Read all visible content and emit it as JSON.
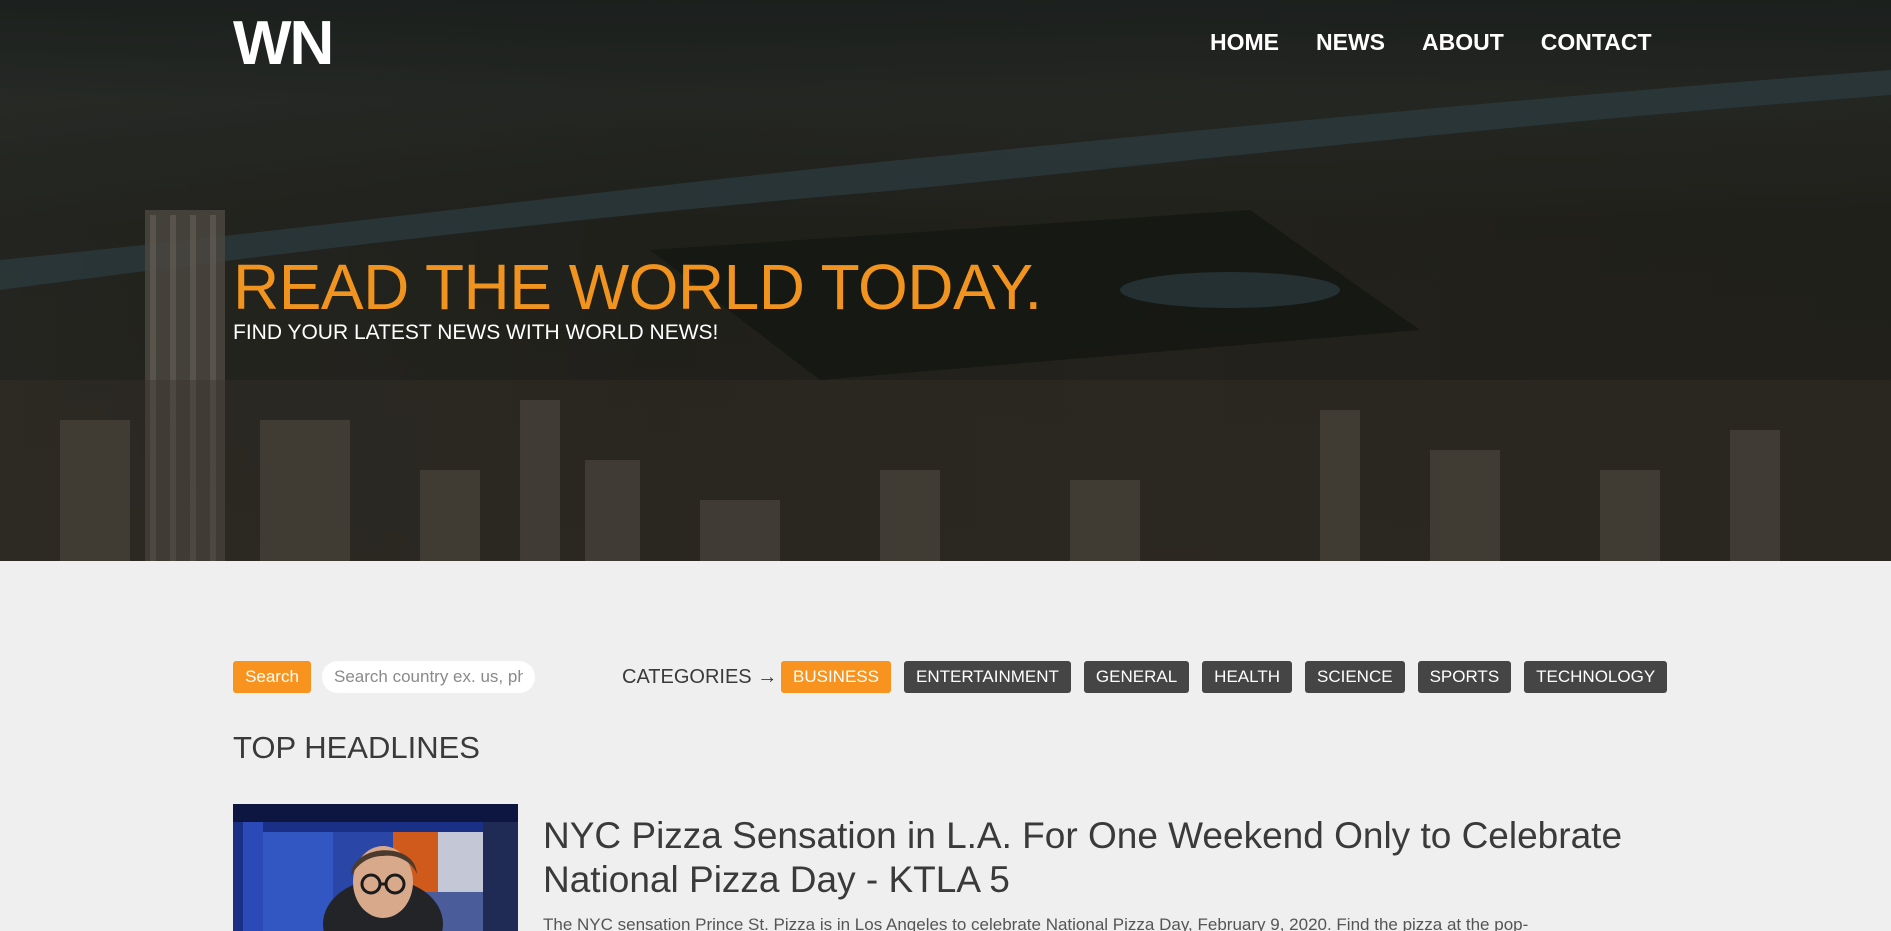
{
  "header": {
    "logo": "WN",
    "nav": [
      "HOME",
      "NEWS",
      "ABOUT",
      "CONTACT"
    ]
  },
  "hero": {
    "title": "READ THE WORLD TODAY.",
    "subtitle": "FIND YOUR LATEST NEWS WITH WORLD NEWS!"
  },
  "search": {
    "button_label": "Search",
    "placeholder": "Search country ex. us, ph"
  },
  "categories": {
    "label": "CATEGORIES →",
    "items": [
      {
        "label": "BUSINESS",
        "active": true
      },
      {
        "label": "ENTERTAINMENT",
        "active": false
      },
      {
        "label": "GENERAL",
        "active": false
      },
      {
        "label": "HEALTH",
        "active": false
      },
      {
        "label": "SCIENCE",
        "active": false
      },
      {
        "label": "SPORTS",
        "active": false
      },
      {
        "label": "TECHNOLOGY",
        "active": false
      }
    ]
  },
  "main": {
    "section_title": "TOP HEADLINES",
    "articles": [
      {
        "title": "NYC Pizza Sensation in L.A. For One Weekend Only to Celebrate National Pizza Day - KTLA 5",
        "description": "The NYC sensation Prince St. Pizza is in Los Angeles to celebrate National Pizza Day, February 9, 2020. Find the pizza at the pop-"
      }
    ]
  },
  "colors": {
    "accent": "#f7931e",
    "hero_title": "#f0931f",
    "category_bg": "#454545",
    "page_bg": "#efefef"
  }
}
